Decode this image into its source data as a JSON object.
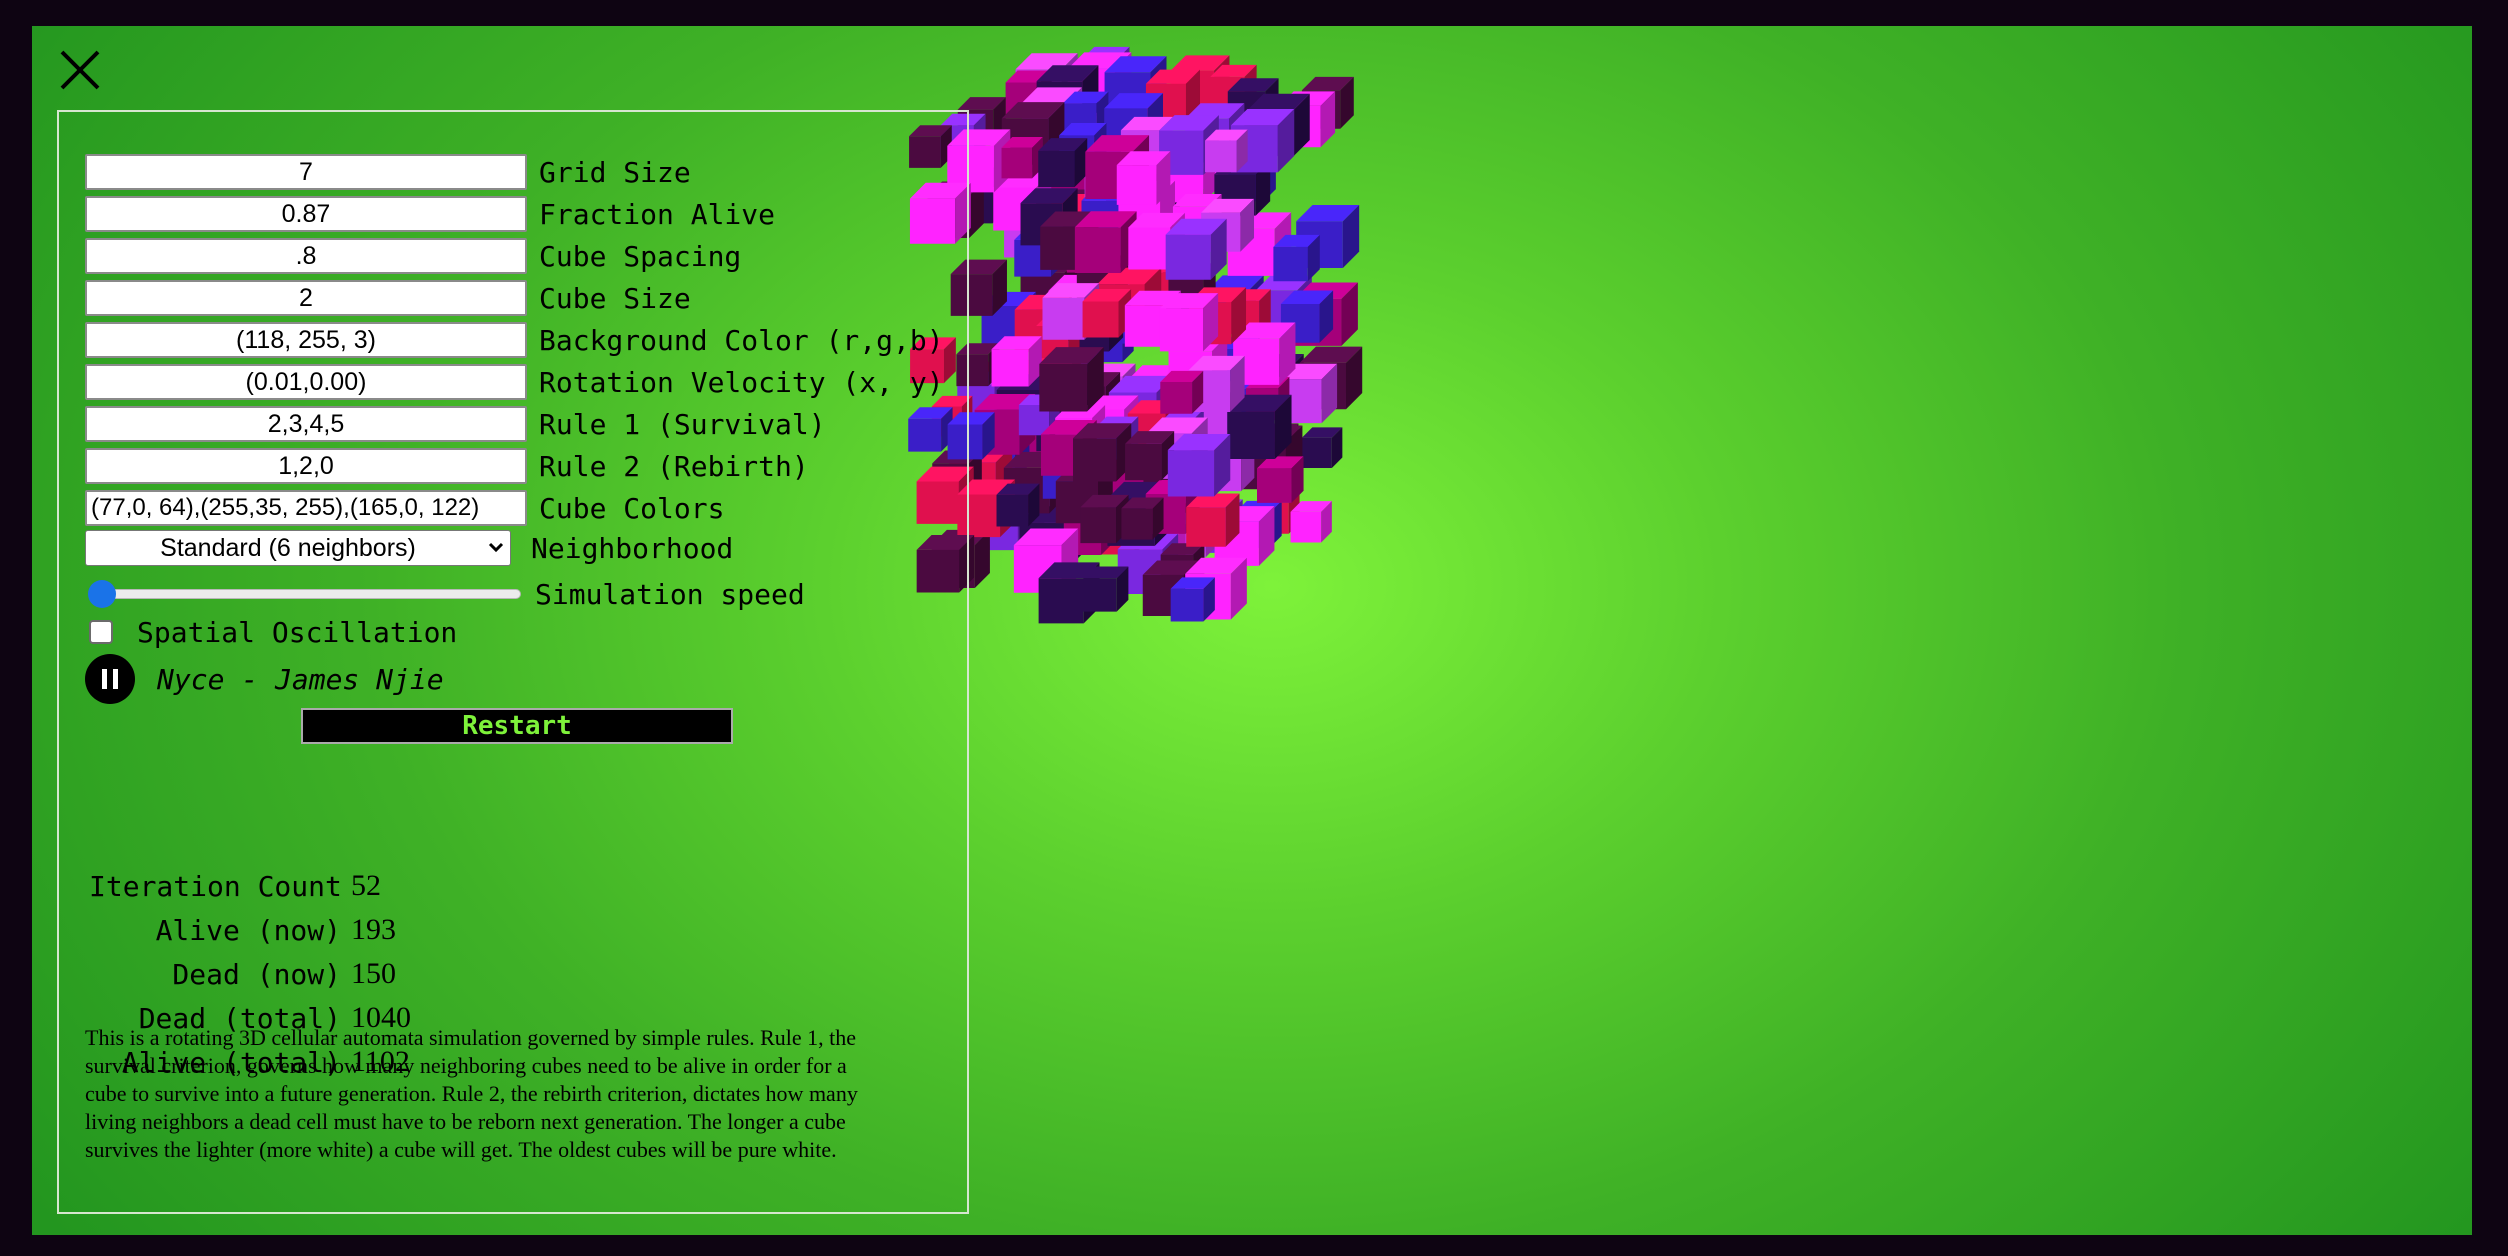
{
  "controls": {
    "grid_size": {
      "value": "7",
      "label": "Grid Size"
    },
    "fraction_alive": {
      "value": "0.87",
      "label": "Fraction Alive"
    },
    "cube_spacing": {
      "value": ".8",
      "label": "Cube Spacing"
    },
    "cube_size": {
      "value": "2",
      "label": "Cube Size"
    },
    "background_color": {
      "value": "(118, 255, 3)",
      "label": "Background Color (r,g,b)"
    },
    "rotation_velocity": {
      "value": "(0.01,0.00)",
      "label": "Rotation Velocity (x, y)"
    },
    "rule1": {
      "value": "2,3,4,5",
      "label": "Rule 1 (Survival)"
    },
    "rule2": {
      "value": "1,2,0",
      "label": "Rule 2 (Rebirth)"
    },
    "cube_colors": {
      "value": "(77,0, 64),(255,35, 255),(165,0, 122)",
      "label": "Cube Colors"
    },
    "neighborhood": {
      "selected": "Standard (6 neighbors)",
      "label": "Neighborhood"
    },
    "simulation_speed": {
      "label": "Simulation speed",
      "level": 0
    },
    "spatial_oscillation": {
      "label": "Spatial Oscillation",
      "checked": false
    }
  },
  "music": {
    "track": "Nyce - James Njie",
    "state": "playing"
  },
  "restart_label": "Restart",
  "stats": [
    {
      "label": "Iteration Count",
      "value": "52"
    },
    {
      "label": "Alive (now)",
      "value": "193"
    },
    {
      "label": "Dead (now)",
      "value": "150"
    },
    {
      "label": "Dead (total)",
      "value": "1040"
    },
    {
      "label": "Alive (total)",
      "value": "1102"
    }
  ],
  "description": "This is a rotating 3D cellular automata simulation governed by simple rules. Rule 1, the survival criterion, governs how many neighboring cubes need to be alive in order for a cube to survive into a future generation. Rule 2, the rebirth criterion, dictates how many living neighbors a dead cell must have to be reborn next generation. The longer a cube survives the lighter (more white) a cube will get. The oldest cubes will be pure white.",
  "icons": {
    "close": "close-icon",
    "pause": "pause-icon",
    "dropdown": "chevron-down-icon"
  },
  "colors": {
    "page_border": "#0e0412",
    "restart_text": "#7ef23a",
    "slider_thumb": "#1a73e8",
    "cube_palette": [
      "#4b0a40",
      "#ff23ff",
      "#a5007a",
      "#3a1ec8",
      "#7a28e0",
      "#e0104e",
      "#c83cf0",
      "#2a0c50"
    ]
  }
}
